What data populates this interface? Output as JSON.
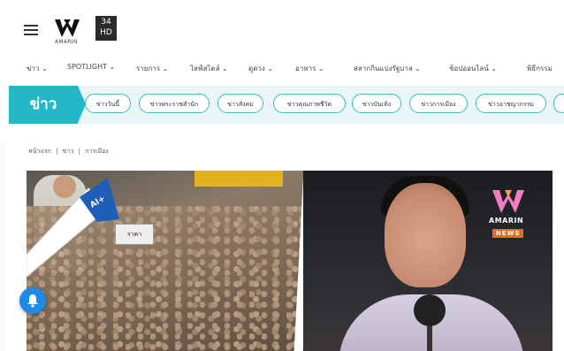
{
  "header": {
    "logo_text": "AMARIN",
    "channel_number": "34",
    "channel_hd": "HD"
  },
  "topnav": {
    "items": [
      "ข่าว ⌄",
      "SPOTLIGHT ⌄",
      "รายการ ⌄",
      "ไลฟ์สไตล์ ⌄",
      "ดูดวง ⌄",
      "อาหาร ⌄",
      "สลากกินแบ่งรัฐบาล ⌄",
      "ช้อปออนไลน์ ⌄",
      "พิธีกรรม"
    ]
  },
  "category": {
    "title": "ข่าว",
    "pills": [
      "ข่าววันนี้",
      "ข่าวพระราชสำนัก",
      "ข่าวสังคม",
      "ข่าวคุณภาพชีวิต",
      "ข่าวบันเทิง",
      "ข่าวการเมือง",
      "ข่าวอาชญากรรม"
    ]
  },
  "breadcrumb": {
    "home": "หน้าแรก",
    "sep": "|",
    "section": "ข่าว",
    "subsection": "การเมือง"
  },
  "hero": {
    "price_sign": "ราคา",
    "badge_text": "AI+",
    "news_logo_word": "AMARIN",
    "news_tag": "NEWS"
  },
  "colors": {
    "accent": "#22b8c6",
    "notification": "#1e8ae6",
    "news_tag": "#e86a2b"
  }
}
